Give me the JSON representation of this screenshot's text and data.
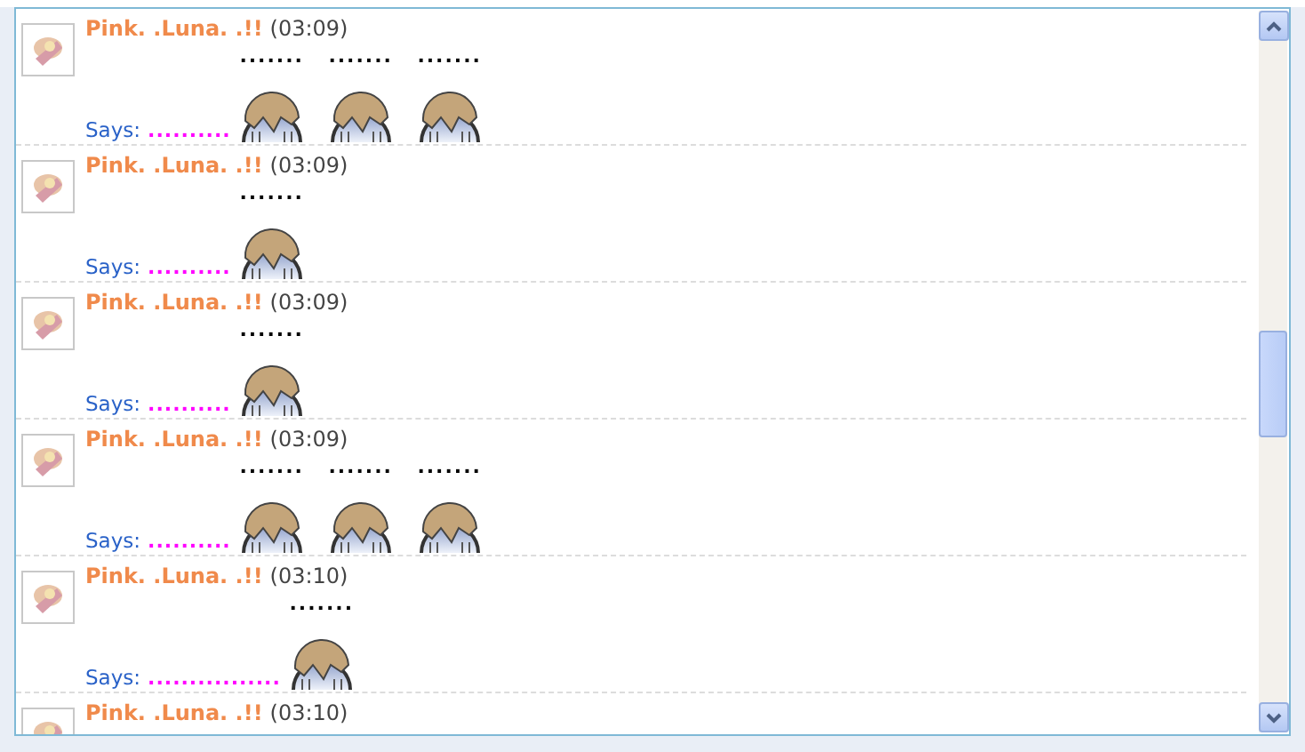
{
  "messages": [
    {
      "name": "Pink. .Luna. .!!",
      "time": "(03:09)",
      "says_label": "Says:",
      "says_text": "..........",
      "emoticons": [
        {
          "caption": "......."
        },
        {
          "caption": "......."
        },
        {
          "caption": "......."
        }
      ]
    },
    {
      "name": "Pink. .Luna. .!!",
      "time": "(03:09)",
      "says_label": "Says:",
      "says_text": "..........",
      "emoticons": [
        {
          "caption": "......."
        }
      ]
    },
    {
      "name": "Pink. .Luna. .!!",
      "time": "(03:09)",
      "says_label": "Says:",
      "says_text": "..........",
      "emoticons": [
        {
          "caption": "......."
        }
      ]
    },
    {
      "name": "Pink. .Luna. .!!",
      "time": "(03:09)",
      "says_label": "Says:",
      "says_text": "..........",
      "emoticons": [
        {
          "caption": "......."
        },
        {
          "caption": "......."
        },
        {
          "caption": "......."
        }
      ]
    },
    {
      "name": "Pink. .Luna. .!!",
      "time": "(03:10)",
      "says_label": "Says:",
      "says_text": "................",
      "emoticons": [
        {
          "caption": "......."
        }
      ]
    },
    {
      "name": "Pink. .Luna. .!!",
      "time": "(03:10)"
    }
  ]
}
